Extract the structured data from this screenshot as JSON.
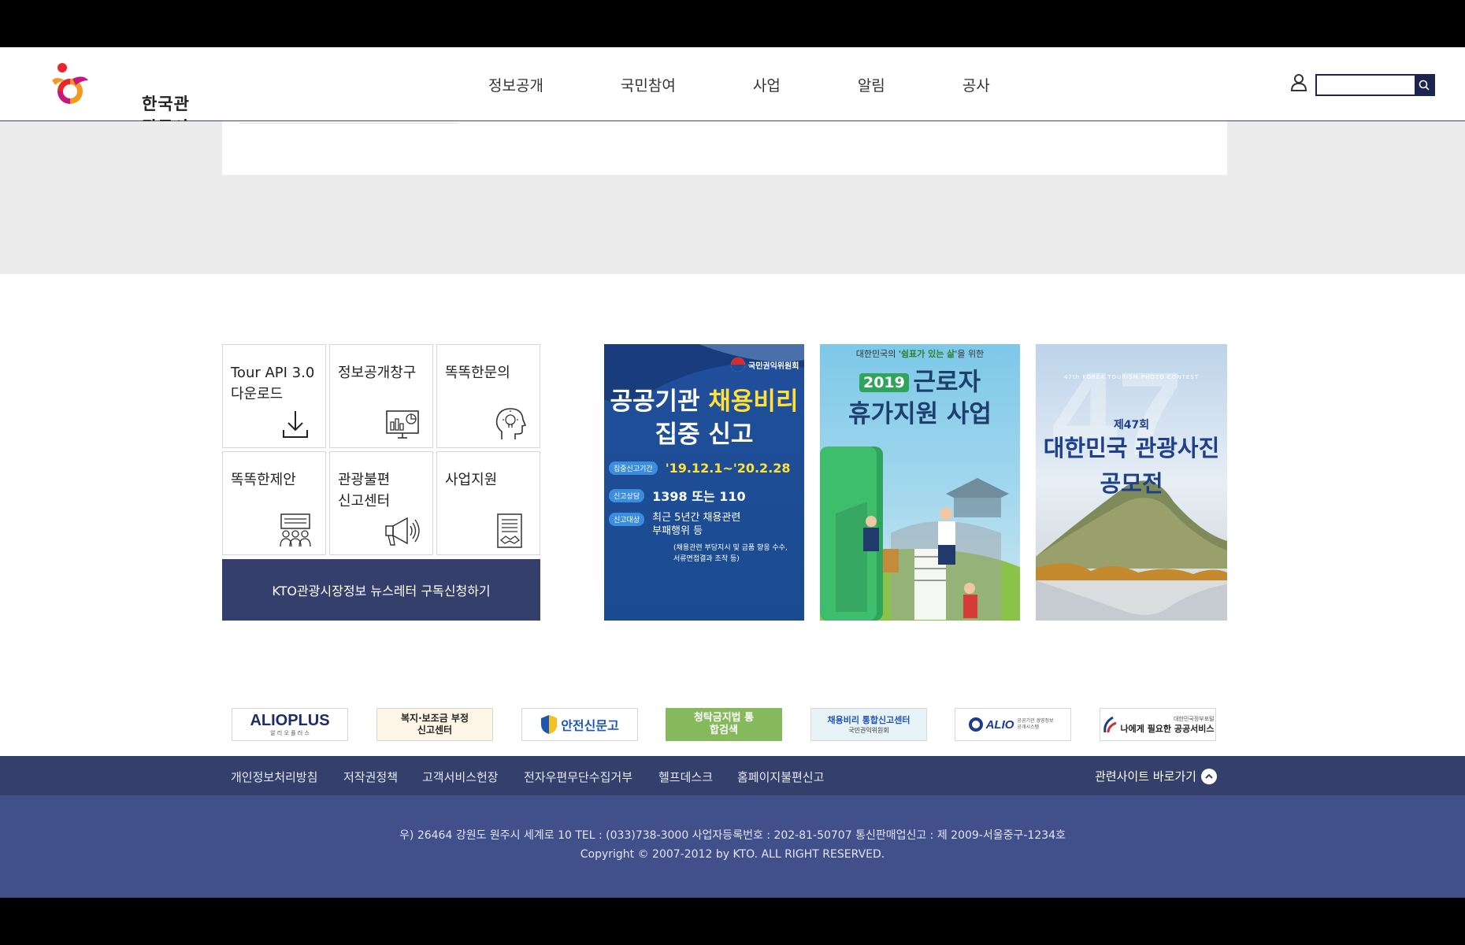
{
  "brand": {
    "name": "한국관광공사"
  },
  "gnb": [
    "정보공개",
    "국민참여",
    "사업",
    "알림",
    "공사"
  ],
  "search": {
    "placeholder": "",
    "value": ""
  },
  "tiles": [
    {
      "label": "Tour API 3.0\n다운로드",
      "icon": "download-icon"
    },
    {
      "label": "정보공개창구",
      "icon": "monitor-chart-icon"
    },
    {
      "label": "똑똑한문의",
      "icon": "head-lightbulb-icon"
    },
    {
      "label": "똑똑한제안",
      "icon": "people-board-icon"
    },
    {
      "label": "관광불편\n신고센터",
      "icon": "megaphone-icon"
    },
    {
      "label": "사업지원",
      "icon": "document-handshake-icon"
    }
  ],
  "newsletter": {
    "label": "KTO관광시장정보 뉴스레터 구독신청하기"
  },
  "banners": {
    "b1": {
      "org": "국민권익위원회",
      "title1a": "공공기관 ",
      "title1b": "채용비리",
      "title2": "집중 신고",
      "rows": [
        {
          "tag": "집중신고기간",
          "text": "'19.12.1~'20.2.28"
        },
        {
          "tag": "신고상담",
          "text": "1398 또는 110"
        },
        {
          "tag": "신고대상",
          "text": "최근 5년간 채용관련\n부패행위 등"
        }
      ],
      "note": "(채용관련 부당지시 및 금품 향응 수수,\n서류면접결과 조작 등)"
    },
    "b2": {
      "sub_pre": "대한민국의 '",
      "sub_em": "쉼표가 있는 삶",
      "sub_post": "'을 위한",
      "year": "2019",
      "title1": "근로자",
      "title2": "휴가지원 사업"
    },
    "b3": {
      "en": "47th KOREA TOURISM PHOTO CONTEST",
      "round": "제47회",
      "title1": "대한민국 관광사진",
      "title2": "공모전"
    }
  },
  "partners": [
    {
      "name": "ALIOPLUS",
      "sub": "알 리 오 플 러 스"
    },
    {
      "name": "복지·보조금 부정 신고센터",
      "sub": ""
    },
    {
      "name": "안전신문고",
      "sub": ""
    },
    {
      "name": "청탁금지법 통합검색",
      "sub": ""
    },
    {
      "name": "채용비리 통합신고센터",
      "sub": "국민권익위원회"
    },
    {
      "name": "ALIO",
      "sub": "공공기관 경영정보 공개시스템"
    },
    {
      "name": "나에게 필요한 공공서비스",
      "sub": "대한민국정부포털"
    }
  ],
  "footer": {
    "links": [
      "개인정보처리방침",
      "저작권정책",
      "고객서비스헌장",
      "전자우편무단수집거부",
      "헬프데스크",
      "홈페이지불편신고"
    ],
    "related": "관련사이트 바로가기",
    "address": "우) 26464 강원도 원주시 세계로 10 TEL : (033)738-3000 사업자등록번호 : 202-81-50707 통신판매업신고 : 제 2009-서울중구-1234호",
    "copyright": "Copyright © 2007-2012 by KTO. ALL RIGHT RESERVED."
  }
}
